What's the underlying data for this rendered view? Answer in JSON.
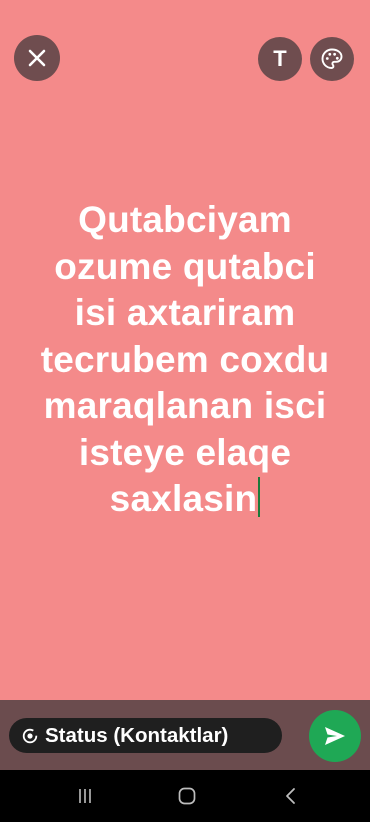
{
  "header": {
    "close_icon": "close-icon",
    "text_tool_label": "T",
    "palette_icon": "palette-icon"
  },
  "status": {
    "background_color": "#f48a8a",
    "text_color": "#ffffff",
    "lines": [
      "Qutabciyam",
      "ozume qutabci",
      "isi axtariram",
      "tecrubem coxdu",
      "maraqlanan isci",
      "isteye elaqe",
      "saxlasin"
    ]
  },
  "footer": {
    "audience_icon": "status-privacy-icon",
    "audience_label": "Status (Kontaktlar)",
    "send_icon": "send-icon",
    "send_color": "#1fa855"
  },
  "system_nav": {
    "recents_icon": "recents-icon",
    "home_icon": "home-icon",
    "back_icon": "back-icon"
  }
}
